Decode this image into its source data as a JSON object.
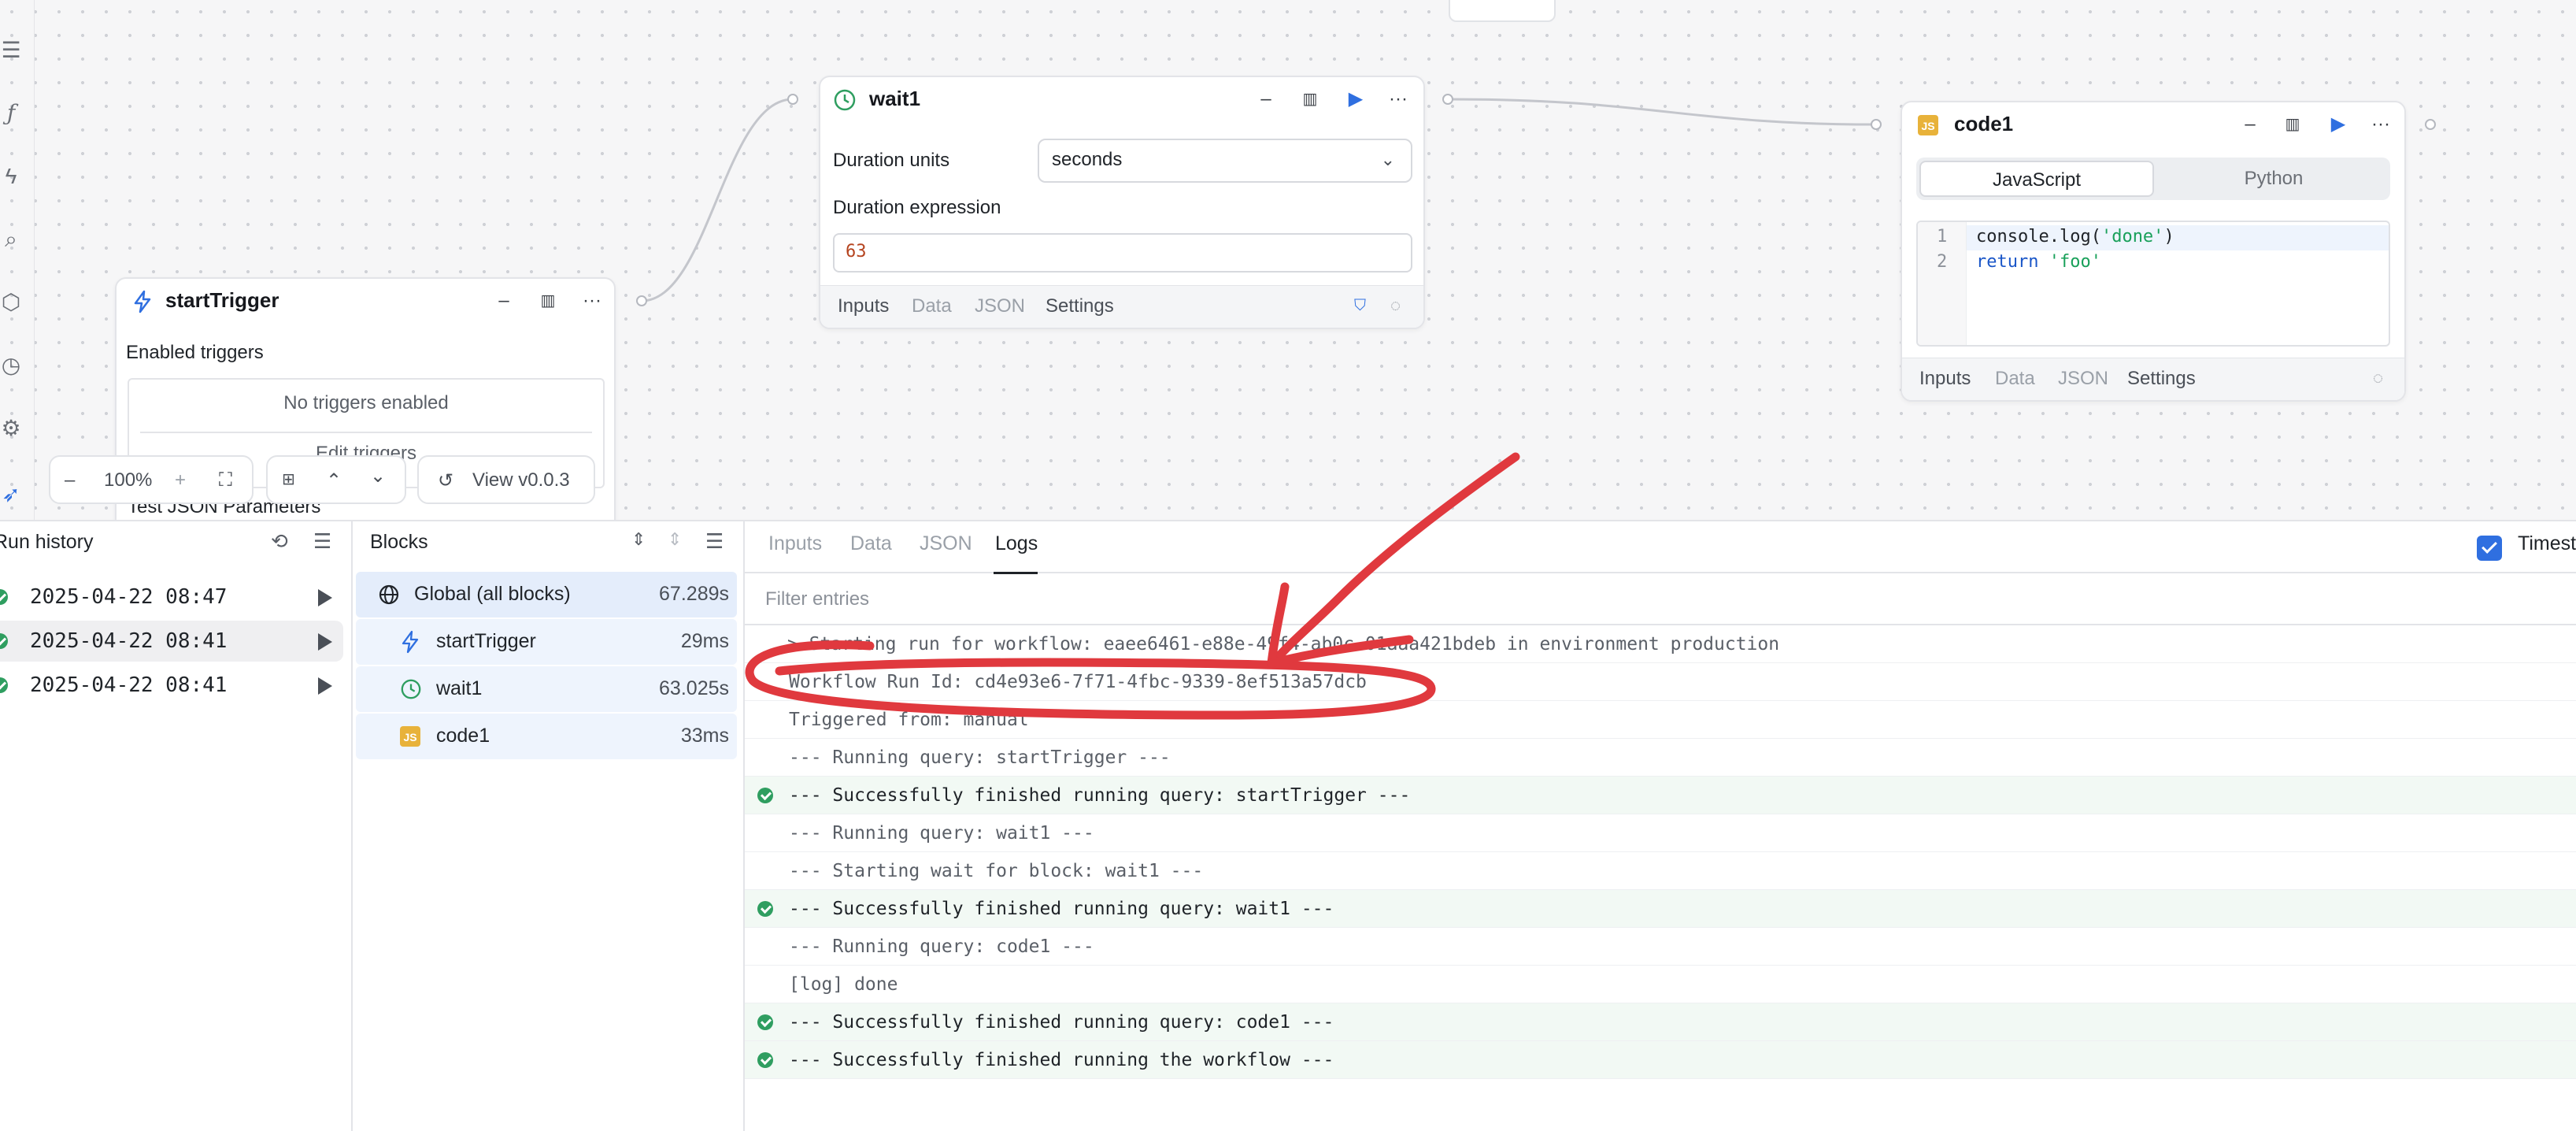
{
  "canvas": {
    "nodes": {
      "start_trigger": {
        "title": "startTrigger",
        "section_label": "Enabled triggers",
        "empty_text": "No triggers enabled",
        "edit_link": "Edit triggers",
        "test_label": "Test JSON Parameters"
      },
      "wait1": {
        "title": "wait1",
        "units_label": "Duration units",
        "units_value": "seconds",
        "expr_label": "Duration expression",
        "expr_value": "63",
        "tabs": [
          "Inputs",
          "Data",
          "JSON",
          "Settings"
        ]
      },
      "code1": {
        "title": "code1",
        "lang_tabs": [
          "JavaScript",
          "Python"
        ],
        "active_lang": "JavaScript",
        "code_lines": [
          "console.log('done')",
          "return 'foo'"
        ],
        "tabs": [
          "Inputs",
          "Data",
          "JSON",
          "Settings"
        ]
      }
    },
    "controls": {
      "zoom": "100%",
      "version_button": "View v0.0.3"
    }
  },
  "run_history": {
    "title": "Run history",
    "runs": [
      {
        "date": "2025-04-22 08:47",
        "status": "success"
      },
      {
        "date": "2025-04-22 08:41",
        "status": "success",
        "active": true
      },
      {
        "date": "2025-04-22 08:41",
        "status": "success"
      }
    ]
  },
  "blocks": {
    "title": "Blocks",
    "items": [
      {
        "name": "Global (all blocks)",
        "time": "67.289s",
        "icon": "globe-icon"
      },
      {
        "name": "startTrigger",
        "time": "29ms",
        "icon": "bolt-icon"
      },
      {
        "name": "wait1",
        "time": "63.025s",
        "icon": "clock-icon"
      },
      {
        "name": "code1",
        "time": "33ms",
        "icon": "js-icon"
      }
    ]
  },
  "logs": {
    "tabs": [
      "Inputs",
      "Data",
      "JSON",
      "Logs"
    ],
    "active_tab": "Logs",
    "filter_placeholder": "Filter entries",
    "timestamps_label": "Timest",
    "entries": [
      {
        "text": "> Starting run for workflow: eaee6461-e88e-49f4-ab0c-01aaa421bdeb in environment production",
        "ok": false
      },
      {
        "text": "Workflow Run Id: cd4e93e6-7f71-4fbc-9339-8ef513a57dcb",
        "ok": false
      },
      {
        "text": "Triggered from: manual",
        "ok": false
      },
      {
        "text": "--- Running query: startTrigger ---",
        "ok": false
      },
      {
        "text": "--- Successfully finished running query: startTrigger ---",
        "ok": true
      },
      {
        "text": "--- Running query: wait1 ---",
        "ok": false
      },
      {
        "text": "--- Starting wait for block: wait1 ---",
        "ok": false
      },
      {
        "text": "--- Successfully finished running query: wait1 ---",
        "ok": true
      },
      {
        "text": "--- Running query: code1 ---",
        "ok": false
      },
      {
        "text": "[log] done",
        "ok": false
      },
      {
        "text": "--- Successfully finished running query: code1 ---",
        "ok": true
      },
      {
        "text": "--- Successfully finished running the workflow ---",
        "ok": true
      }
    ]
  },
  "colors": {
    "accent_blue": "#2f6fe0",
    "success_green": "#2f9e60",
    "annotation_red": "#e0393e",
    "js_badge": "#e8b23a"
  }
}
